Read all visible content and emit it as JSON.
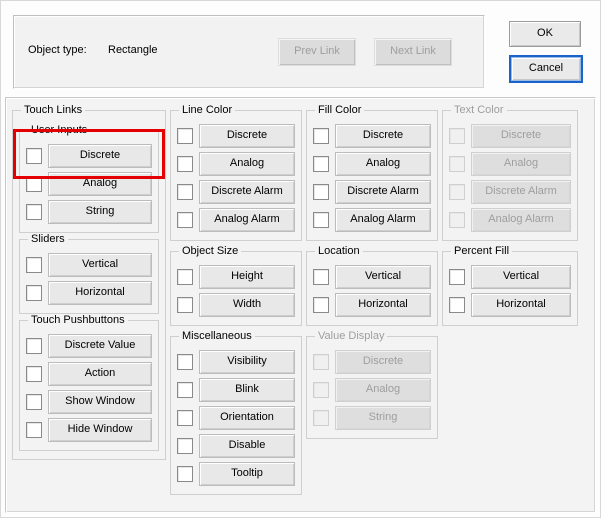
{
  "header": {
    "object_type_label": "Object type:",
    "object_type_value": "Rectangle",
    "prev_link": "Prev Link",
    "next_link": "Next Link",
    "ok": "OK",
    "cancel": "Cancel"
  },
  "groups": {
    "touch_links": "Touch Links",
    "user_inputs": "User Inputs",
    "sliders": "Sliders",
    "touch_pushbuttons": "Touch Pushbuttons",
    "line_color": "Line Color",
    "fill_color": "Fill Color",
    "text_color": "Text Color",
    "object_size": "Object Size",
    "location": "Location",
    "percent_fill": "Percent Fill",
    "miscellaneous": "Miscellaneous",
    "value_display": "Value Display"
  },
  "user_inputs": {
    "discrete": "Discrete",
    "analog": "Analog",
    "string": "String"
  },
  "sliders": {
    "vertical": "Vertical",
    "horizontal": "Horizontal"
  },
  "touch_pushbuttons": {
    "discrete_value": "Discrete Value",
    "action": "Action",
    "show_window": "Show Window",
    "hide_window": "Hide Window"
  },
  "color": {
    "discrete": "Discrete",
    "analog": "Analog",
    "discrete_alarm": "Discrete Alarm",
    "analog_alarm": "Analog Alarm"
  },
  "object_size": {
    "height": "Height",
    "width": "Width"
  },
  "location": {
    "vertical": "Vertical",
    "horizontal": "Horizontal"
  },
  "percent_fill": {
    "vertical": "Vertical",
    "horizontal": "Horizontal"
  },
  "misc": {
    "visibility": "Visibility",
    "blink": "Blink",
    "orientation": "Orientation",
    "disable": "Disable",
    "tooltip": "Tooltip"
  },
  "value_display": {
    "discrete": "Discrete",
    "analog": "Analog",
    "string": "String"
  }
}
